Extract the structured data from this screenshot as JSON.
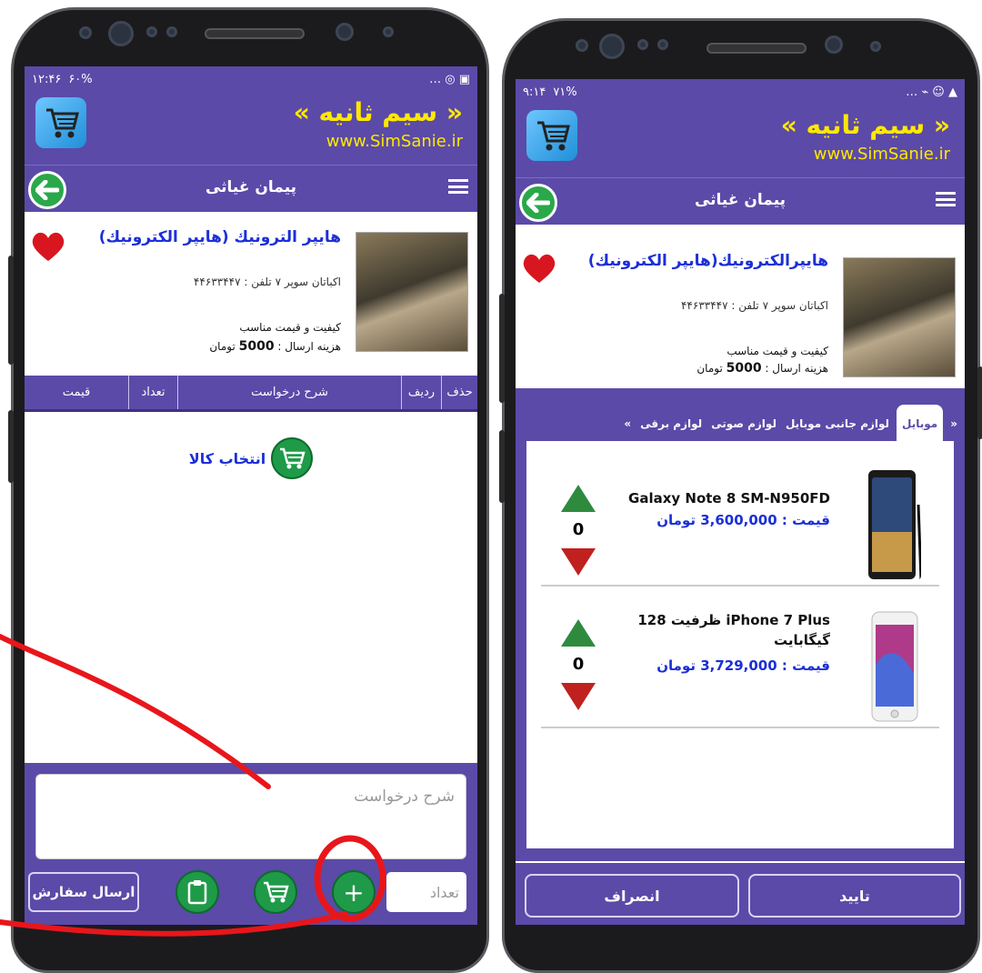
{
  "left": {
    "status_time": "۱۲:۴۶",
    "status_battery": "۶۰%",
    "brand_title": "« سیم ثانیه »",
    "brand_url": "www.SimSanie.ir",
    "user_name": "پیمان غیاثی",
    "shop_name": "هایپر الترونیك (هایپر الكترونیك)",
    "shop_address": "اکباتان سوپر ۷ تلفن : ۴۴۶۳۳۴۴۷",
    "shop_quality": "کیفیت و قیمت مناسب",
    "shop_shipping_prefix": "هزینه ارسال :",
    "shop_shipping_value": "5000",
    "shop_shipping_unit": "تومان",
    "table_headers": [
      "حذف",
      "ردیف",
      "شرح درخواست",
      "تعداد",
      "قیمت"
    ],
    "select_item_label": "انتخاب کالا",
    "description_placeholder": "شرح درخواست",
    "quantity_placeholder": "تعداد",
    "add_symbol": "+",
    "send_order_label": "ارسال سفارش"
  },
  "right": {
    "status_time": "۹:۱۴",
    "status_battery": "۷۱%",
    "brand_title": "« سیم ثانیه »",
    "brand_url": "www.SimSanie.ir",
    "user_name": "پیمان غیاثی",
    "shop_name": "هایپرالکترونیك(هایپر الکترونیك)",
    "shop_address": "اکباتان سوپر ۷ تلفن : ۴۴۶۳۳۴۴۷",
    "shop_quality": "کیفیت و قیمت مناسب",
    "shop_shipping_prefix": "هزینه ارسال :",
    "shop_shipping_value": "5000",
    "shop_shipping_unit": "تومان",
    "tabs": [
      "«",
      "موبایل",
      "لوازم جانبی موبایل",
      "لوازم صوتی",
      "لوازم برقی",
      "»"
    ],
    "products": [
      {
        "name": "Galaxy Note 8 SM-N950FD",
        "price": "قیمت : 3,600,000 تومان",
        "qty": "0"
      },
      {
        "name": "iPhone 7 Plus ظرفیت 128 گیگابایت",
        "price": "قیمت : 3,729,000 تومان",
        "qty": "0"
      }
    ],
    "confirm_label": "تایید",
    "cancel_label": "انصراف"
  },
  "colors": {
    "header_purple": "#5b4aa8",
    "brand_yellow": "#ffe800",
    "link_blue": "#1b2fd8",
    "button_green": "#1f9a49",
    "annotation_red": "#e8161b"
  }
}
